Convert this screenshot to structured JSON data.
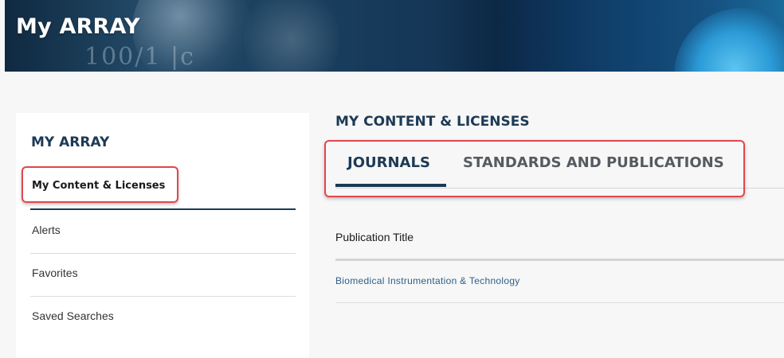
{
  "banner": {
    "title": "My ARRAY",
    "background_text": "100/1 |c"
  },
  "sidebar": {
    "heading": "MY ARRAY",
    "items": [
      {
        "label": "My Content & Licenses",
        "active": true
      },
      {
        "label": "Alerts",
        "active": false
      },
      {
        "label": "Favorites",
        "active": false
      },
      {
        "label": "Saved Searches",
        "active": false
      }
    ]
  },
  "main": {
    "heading": "MY CONTENT & LICENSES",
    "tabs": [
      {
        "label": "JOURNALS",
        "active": true
      },
      {
        "label": "STANDARDS AND PUBLICATIONS",
        "active": false
      }
    ],
    "table": {
      "column_header": "Publication Title",
      "rows": [
        {
          "title": "Biomedical Instrumentation & Technology"
        }
      ]
    }
  },
  "colors": {
    "heading_navy": "#1d3a55",
    "highlight_red": "#e0474c",
    "link_blue": "#2c5f8a"
  }
}
